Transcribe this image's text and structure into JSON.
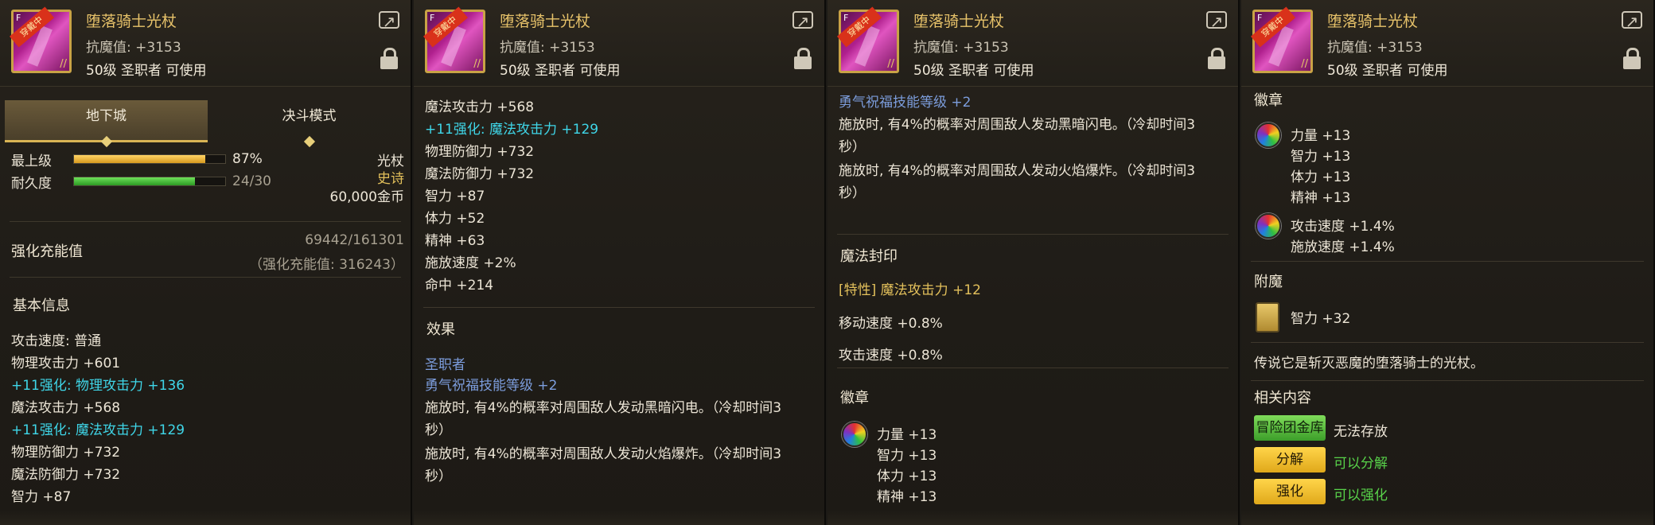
{
  "item": {
    "name": "堕落骑士光杖",
    "stat_line": "抗魔值: +3153",
    "requirement": "50级 圣职者 可使用",
    "badge": "穿戴中",
    "level_tag": "F"
  },
  "panel1": {
    "tabs": [
      "地下城",
      "决斗模式"
    ],
    "grade_label": "最上级",
    "grade_percent": "87%",
    "grade_fill": 0.87,
    "durability_label": "耐久度",
    "durability_value": "24/30",
    "durability_fill": 0.8,
    "type": "光杖",
    "rarity": "史诗",
    "price": "60,000金币",
    "reinforce_charge_label": "强化充能值",
    "reinforce_charge_value": "69442/161301",
    "reinforce_charge_sub": "（强化充能值: 316243）",
    "basic_info_heading": "基本信息",
    "lines": [
      {
        "text": "攻击速度: 普通",
        "cls": "white"
      },
      {
        "text": "物理攻击力 +601",
        "cls": "white"
      },
      {
        "text": "+11强化: 物理攻击力 +136",
        "cls": "cyan"
      },
      {
        "text": "魔法攻击力 +568",
        "cls": "white"
      },
      {
        "text": "+11强化: 魔法攻击力 +129",
        "cls": "cyan"
      },
      {
        "text": "物理防御力 +732",
        "cls": "white"
      },
      {
        "text": "魔法防御力 +732",
        "cls": "white"
      },
      {
        "text": "智力 +87",
        "cls": "white"
      }
    ]
  },
  "panel2": {
    "lines": [
      {
        "text": "魔法攻击力 +568",
        "cls": "white"
      },
      {
        "text": "+11强化: 魔法攻击力 +129",
        "cls": "cyan"
      },
      {
        "text": "物理防御力 +732",
        "cls": "white"
      },
      {
        "text": "魔法防御力 +732",
        "cls": "white"
      },
      {
        "text": "智力 +87",
        "cls": "white"
      },
      {
        "text": "体力 +52",
        "cls": "white"
      },
      {
        "text": "精神 +63",
        "cls": "white"
      },
      {
        "text": "施放速度 +2%",
        "cls": "white"
      },
      {
        "text": "命中 +214",
        "cls": "white"
      }
    ],
    "effect_heading": "效果",
    "class_name": "圣职者",
    "skill_boost": "勇气祝福技能等级 +2",
    "effect1_a": "施放时, 有4%的概率对周围敌人发动黑暗闪电。（冷却时间3",
    "effect1_b": "秒）",
    "effect2_a": "施放时, 有4%的概率对周围敌人发动火焰爆炸。（冷却时间3",
    "effect2_b": "秒）"
  },
  "panel3": {
    "skill_boost": "勇气祝福技能等级 +2",
    "effect1_a": "施放时, 有4%的概率对周围敌人发动黑暗闪电。（冷却时间3",
    "effect1_b": "秒）",
    "effect2_a": "施放时, 有4%的概率对周围敌人发动火焰爆炸。（冷却时间3",
    "effect2_b": "秒）",
    "seal_heading": "魔法封印",
    "seal_trait": "[特性] 魔法攻击力 +12",
    "seal_move": "移动速度 +0.8%",
    "seal_atk": "攻击速度 +0.8%",
    "emblem_heading": "徽章",
    "emblem_stats": [
      "力量 +13",
      "智力 +13",
      "体力 +13",
      "精神 +13"
    ]
  },
  "panel4": {
    "emblem_heading": "徽章",
    "emblem1_stats": [
      "力量 +13",
      "智力 +13",
      "体力 +13",
      "精神 +13"
    ],
    "emblem2_stats": [
      "攻击速度 +1.4%",
      "施放速度 +1.4%"
    ],
    "enchant_heading": "附魔",
    "enchant_stat": "智力 +32",
    "flavor": "传说它是斩灭恶魔的堕落骑士的光杖。",
    "related_heading": "相关内容",
    "related": [
      {
        "button": "冒险团金库",
        "status": "无法存放",
        "style": "green-btn",
        "status_cls": "white"
      },
      {
        "button": "分解",
        "status": "可以分解",
        "style": "gold-btn",
        "status_cls": "green"
      },
      {
        "button": "强化",
        "status": "可以强化",
        "style": "gold-btn",
        "status_cls": "green"
      }
    ]
  },
  "icons": [
    "share-icon",
    "lock-icon",
    "emblem-orb-icon",
    "enchant-card-icon"
  ],
  "colors": {
    "enhance": "#3fd6e8",
    "skill": "#7c9ddc",
    "rarity": "#e3c05b",
    "positive": "#58d24a",
    "title": "#e8c36a"
  }
}
